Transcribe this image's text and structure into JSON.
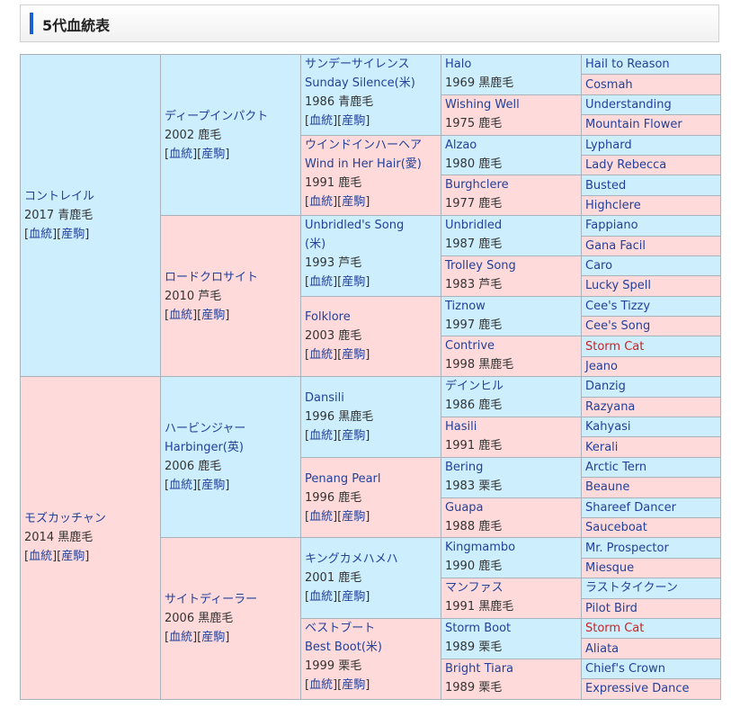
{
  "header": {
    "title": "5代血統表"
  },
  "labels": {
    "pedigree": "血統",
    "progeny": "産駒"
  },
  "colors": {
    "sire_bg": "#cdeffd",
    "dam_bg": "#fedada",
    "link": "#23409a",
    "redlink": "#cc2222",
    "accent": "#1a5fd6"
  },
  "gen1": [
    {
      "name": "コントレイル",
      "info": "2017 青鹿毛"
    },
    {
      "name": "モズカッチャン",
      "info": "2014 黒鹿毛"
    }
  ],
  "gen2": [
    {
      "name": "ディープインパクト",
      "info": "2002 鹿毛"
    },
    {
      "name": "ロードクロサイト",
      "info": "2010 芦毛"
    },
    {
      "name": "ハービンジャー",
      "name2": "Harbinger(英)",
      "info": "2006 鹿毛"
    },
    {
      "name": "サイトディーラー",
      "info": "2006 黒鹿毛"
    }
  ],
  "gen3": [
    {
      "name": "サンデーサイレンス",
      "name2": "Sunday Silence(米)",
      "info": "1986 青鹿毛"
    },
    {
      "name": "ウインドインハーヘア",
      "name2": "Wind in Her Hair(愛)",
      "info": "1991 鹿毛"
    },
    {
      "name": "Unbridled's Song",
      "name2": "(米)",
      "info": "1993 芦毛"
    },
    {
      "name": "Folklore",
      "info": "2003 鹿毛"
    },
    {
      "name": "Dansili",
      "info": "1996 黒鹿毛"
    },
    {
      "name": "Penang Pearl",
      "info": "1996 鹿毛"
    },
    {
      "name": "キングカメハメハ",
      "info": "2001 鹿毛"
    },
    {
      "name": "ベストブート",
      "name2": "Best Boot(米)",
      "info": "1999 栗毛"
    }
  ],
  "gen4": [
    {
      "name": "Halo",
      "info": "1969 黒鹿毛"
    },
    {
      "name": "Wishing Well",
      "info": "1975 鹿毛"
    },
    {
      "name": "Alzao",
      "info": "1980 鹿毛"
    },
    {
      "name": "Burghclere",
      "info": "1977 鹿毛"
    },
    {
      "name": "Unbridled",
      "info": "1987 鹿毛"
    },
    {
      "name": "Trolley Song",
      "info": "1983 芦毛"
    },
    {
      "name": "Tiznow",
      "info": "1997 鹿毛"
    },
    {
      "name": "Contrive",
      "info": "1998 黒鹿毛"
    },
    {
      "name": "デインヒル",
      "info": "1986 鹿毛"
    },
    {
      "name": "Hasili",
      "info": "1991 鹿毛"
    },
    {
      "name": "Bering",
      "info": "1983 栗毛"
    },
    {
      "name": "Guapa",
      "info": "1988 鹿毛"
    },
    {
      "name": "Kingmambo",
      "info": "1990 鹿毛"
    },
    {
      "name": "マンファス",
      "info": "1991 黒鹿毛"
    },
    {
      "name": "Storm Boot",
      "info": "1989 栗毛"
    },
    {
      "name": "Bright Tiara",
      "info": "1989 栗毛"
    }
  ],
  "gen5": [
    {
      "name": "Hail to Reason"
    },
    {
      "name": "Cosmah"
    },
    {
      "name": "Understanding"
    },
    {
      "name": "Mountain Flower"
    },
    {
      "name": "Lyphard"
    },
    {
      "name": "Lady Rebecca"
    },
    {
      "name": "Busted"
    },
    {
      "name": "Highclere"
    },
    {
      "name": "Fappiano"
    },
    {
      "name": "Gana Facil"
    },
    {
      "name": "Caro"
    },
    {
      "name": "Lucky Spell"
    },
    {
      "name": "Cee's Tizzy"
    },
    {
      "name": "Cee's Song"
    },
    {
      "name": "Storm Cat",
      "red": true
    },
    {
      "name": "Jeano"
    },
    {
      "name": "Danzig"
    },
    {
      "name": "Razyana"
    },
    {
      "name": "Kahyasi"
    },
    {
      "name": "Kerali"
    },
    {
      "name": "Arctic Tern"
    },
    {
      "name": "Beaune"
    },
    {
      "name": "Shareef Dancer"
    },
    {
      "name": "Sauceboat"
    },
    {
      "name": "Mr. Prospector"
    },
    {
      "name": "Miesque"
    },
    {
      "name": "ラストタイクーン"
    },
    {
      "name": "Pilot Bird"
    },
    {
      "name": "Storm Cat",
      "red": true
    },
    {
      "name": "Aliata"
    },
    {
      "name": "Chief's Crown"
    },
    {
      "name": "Expressive Dance"
    }
  ]
}
